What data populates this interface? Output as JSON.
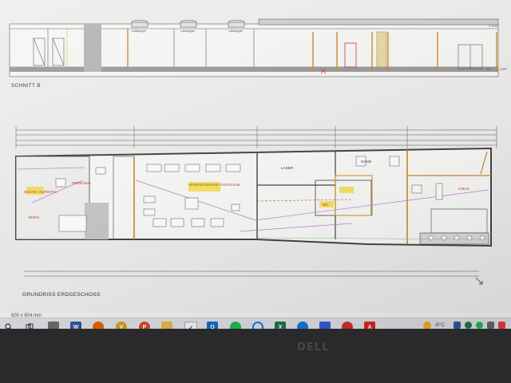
{
  "section_view": {
    "title": "SCHNITT B",
    "scale_note": "1:100",
    "annotations": [
      "Lichtkuppel",
      "Lichtkuppel",
      "Lichtkuppel",
      "EG",
      "OKFF"
    ]
  },
  "floor_plan": {
    "title": "GRUNDRISS ERDGESCHOSS",
    "rooms": [
      {
        "name": "PERSONAL"
      },
      {
        "name": "KÜCHE / AUFENTH."
      },
      {
        "name": "BÜRO"
      },
      {
        "name": "VERKAUFSRAUM GASTRAUM"
      },
      {
        "name": "LAGER"
      },
      {
        "name": "GANG"
      },
      {
        "name": "WC"
      },
      {
        "name": "LOKAL"
      }
    ]
  },
  "status": {
    "dimensions": "600 x 604 mm"
  },
  "taskbar": {
    "apps": [
      {
        "name": "search-icon",
        "color": "#333333"
      },
      {
        "name": "task-view-icon",
        "color": "#333333"
      },
      {
        "name": "store-icon",
        "color": "#6b6b6b"
      },
      {
        "name": "word-icon",
        "color": "#2b579a"
      },
      {
        "name": "firefox-icon",
        "color": "#e66000"
      },
      {
        "name": "vectorworks-icon",
        "color": "#d59b1c"
      },
      {
        "name": "powerpoint-icon",
        "color": "#d24726"
      },
      {
        "name": "file-explorer-icon",
        "color": "#e8b44a"
      },
      {
        "name": "checklist-icon",
        "color": "#8a8a8a"
      },
      {
        "name": "outlook-icon",
        "color": "#0f6cbd"
      },
      {
        "name": "spotify-icon",
        "color": "#1db954"
      },
      {
        "name": "cortana-icon",
        "color": "#1a73e8"
      },
      {
        "name": "excel-icon",
        "color": "#217346"
      },
      {
        "name": "edge-icon",
        "color": "#0f78d4"
      },
      {
        "name": "onedrive-icon",
        "color": "#3759d4"
      },
      {
        "name": "antivirus-icon",
        "color": "#c7322b"
      },
      {
        "name": "acrobat-icon",
        "color": "#d7261e"
      }
    ],
    "tray": {
      "temperature": "-5°C"
    }
  },
  "bezel": {
    "logo": "DELL"
  }
}
